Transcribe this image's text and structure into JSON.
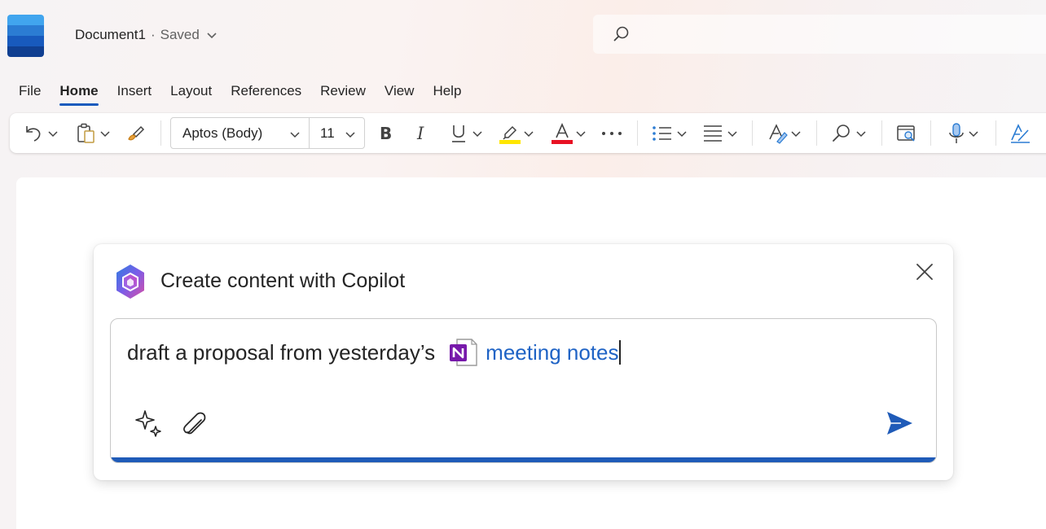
{
  "app": {
    "brand_colors": [
      "#41a5ee",
      "#2b7cd3",
      "#185abd",
      "#103f91"
    ],
    "icon": "word-logo-icon"
  },
  "title_bar": {
    "doc_name": "Document1",
    "separator": "·",
    "status": "Saved",
    "search_icon": "search-icon"
  },
  "menu": {
    "tabs": [
      {
        "label": "File"
      },
      {
        "label": "Home",
        "active": true
      },
      {
        "label": "Insert"
      },
      {
        "label": "Layout"
      },
      {
        "label": "References"
      },
      {
        "label": "Review"
      },
      {
        "label": "View"
      },
      {
        "label": "Help"
      }
    ]
  },
  "ribbon": {
    "font_name": "Aptos (Body)",
    "font_size": "11",
    "highlight_color": "#ffe600",
    "font_color": "#e81123",
    "tools": [
      "undo-icon",
      "paste-icon",
      "format-painter-icon",
      "bold-icon",
      "italic-icon",
      "underline-icon",
      "highlight-icon",
      "font-color-icon",
      "more-icon",
      "bullets-icon",
      "align-icon",
      "styles-icon",
      "find-icon",
      "reuse-files-icon",
      "dictate-icon",
      "editor-icon"
    ]
  },
  "copilot": {
    "title": "Create content with Copilot",
    "prompt_text": "draft a proposal from yesterday’s",
    "reference_label": "meeting notes",
    "reference_icon": "onenote-icon",
    "accent_color": "#1f5bb8"
  }
}
